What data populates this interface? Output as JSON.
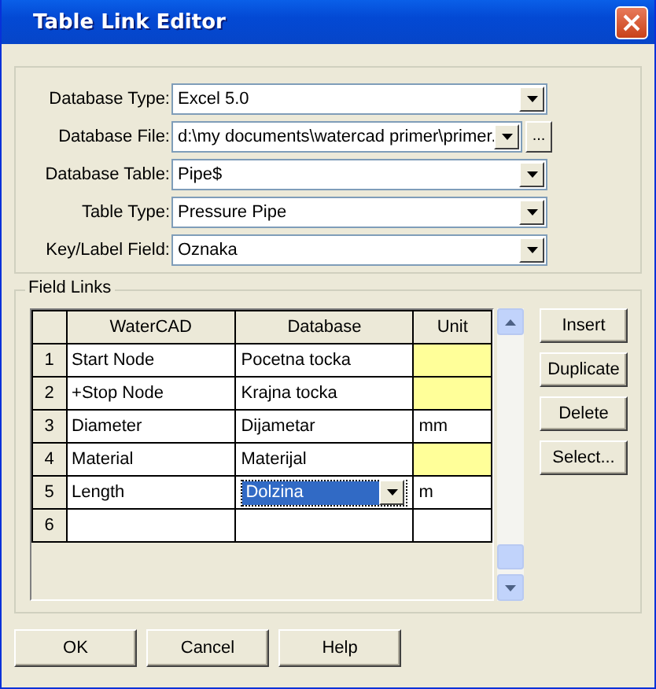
{
  "window": {
    "title": "Table Link Editor"
  },
  "settings": [
    {
      "label": "Database Type:",
      "value": "Excel 5.0"
    },
    {
      "label": "Database File:",
      "value": "d:\\my documents\\watercad primer\\primer.",
      "browse_button": "..."
    },
    {
      "label": "Database Table:",
      "value": "Pipe$"
    },
    {
      "label": "Table Type:",
      "value": "Pressure Pipe"
    },
    {
      "label": "Key/Label Field:",
      "value": "Oznaka"
    }
  ],
  "field_links": {
    "title": "Field Links",
    "columns": [
      "WaterCAD",
      "Database",
      "Unit"
    ],
    "rows": [
      {
        "number": "1",
        "watercad": "Start Node",
        "database": "Pocetna tocka",
        "unit_required": true,
        "editing": false
      },
      {
        "number": "2",
        "watercad": "+Stop Node",
        "database": "Krajna tocka",
        "unit_required": true,
        "editing": false
      },
      {
        "number": "3",
        "watercad": "Diameter",
        "database": "Dijametar",
        "unit": "mm",
        "unit_required": false,
        "editing": false
      },
      {
        "number": "4",
        "watercad": "Material",
        "database": "Materijal",
        "unit_required": true,
        "editing": false
      },
      {
        "number": "5",
        "watercad": "Length",
        "database": "Dolzina",
        "unit": "m",
        "unit_required": false,
        "editing": true
      },
      {
        "number": "6",
        "unit_required": false,
        "editing": false
      }
    ],
    "side_buttons": [
      "Insert",
      "Duplicate",
      "Delete",
      "Select..."
    ]
  },
  "buttons": [
    "OK",
    "Cancel",
    "Help"
  ]
}
